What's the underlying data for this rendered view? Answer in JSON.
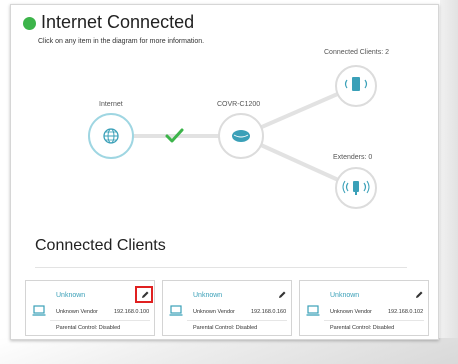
{
  "status": {
    "title": "Internet Connected",
    "hint": "Click on any item in the diagram for more information.",
    "color": "#3cb44a"
  },
  "diagram": {
    "internet_label": "Internet",
    "router_label": "COVR-C1200",
    "clients_label": "Connected Clients: 2",
    "extenders_label": "Extenders: 0",
    "accent": "#3aa0b8",
    "check_color": "#3cb44a",
    "icons": [
      "globe-icon",
      "router-icon",
      "client-device-icon",
      "extender-icon",
      "check-icon"
    ]
  },
  "clients": {
    "heading": "Connected Clients",
    "cards": [
      {
        "name": "Unknown",
        "vendor": "Unknown Vendor",
        "ip": "192.168.0.100",
        "parental": "Parental Control: Disabled",
        "highlighted": true
      },
      {
        "name": "Unknown",
        "vendor": "Unknown Vendor",
        "ip": "192.168.0.160",
        "parental": "Parental Control: Disabled",
        "highlighted": false
      },
      {
        "name": "Unknown",
        "vendor": "Unknown Vendor",
        "ip": "192.168.0.102",
        "parental": "Parental Control: Disabled",
        "highlighted": false
      }
    ]
  }
}
